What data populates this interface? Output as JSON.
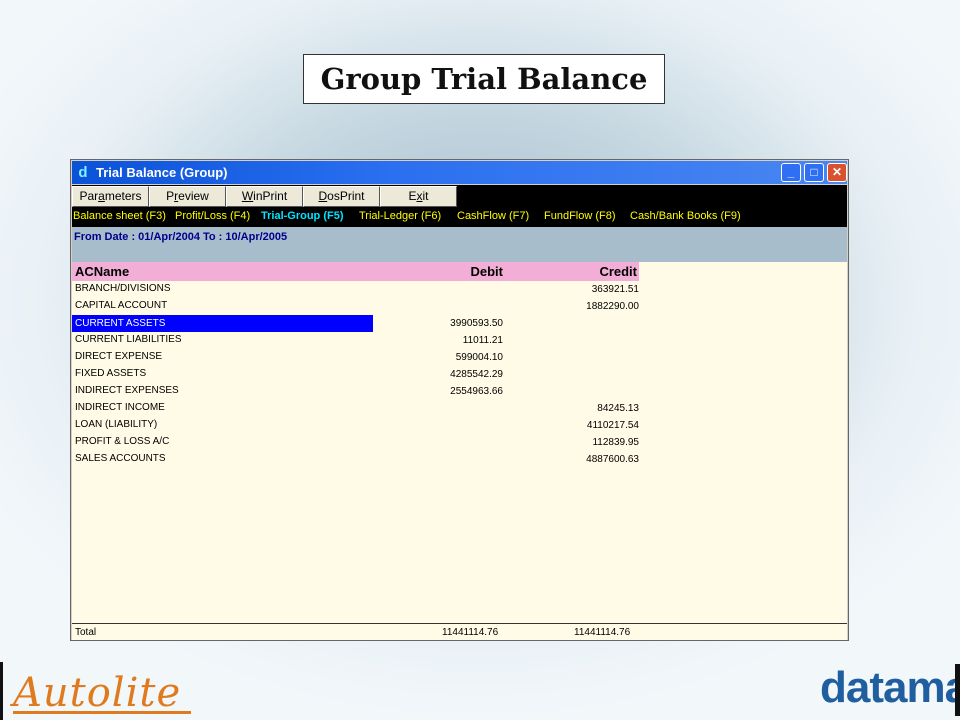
{
  "slide": {
    "title": "Group Trial Balance",
    "title_tail": " "
  },
  "window": {
    "title": "Trial Balance (Group)",
    "app_icon": "d",
    "controls": {
      "minimize": "_",
      "maximize": "□",
      "close": "✕"
    }
  },
  "toolbar": {
    "buttons": [
      {
        "pre": "Par",
        "hot": "a",
        "post": "meters"
      },
      {
        "pre": "P",
        "hot": "r",
        "post": "eview"
      },
      {
        "pre": "",
        "hot": "W",
        "post": "inPrint"
      },
      {
        "pre": "",
        "hot": "D",
        "post": "osPrint"
      },
      {
        "pre": "E",
        "hot": "x",
        "post": "it"
      }
    ]
  },
  "menu": {
    "items": [
      "Balance sheet (F3)",
      "Profit/Loss (F4)",
      "Trial-Group (F5)",
      "Trial-Ledger (F6)",
      "CashFlow (F7)",
      "FundFlow (F8)",
      "Cash/Bank Books (F9)"
    ],
    "active_index": 2
  },
  "date_range": "From Date : 01/Apr/2004 To : 10/Apr/2005",
  "table": {
    "columns": {
      "name": "ACName",
      "debit": "Debit",
      "credit": "Credit"
    },
    "selected_index": 2,
    "rows": [
      {
        "name": "BRANCH/DIVISIONS",
        "debit": "",
        "credit": "363921.51"
      },
      {
        "name": "CAPITAL ACCOUNT",
        "debit": "",
        "credit": "1882290.00"
      },
      {
        "name": "CURRENT ASSETS",
        "debit": "3990593.50",
        "credit": ""
      },
      {
        "name": "CURRENT LIABILITIES",
        "debit": "11011.21",
        "credit": ""
      },
      {
        "name": "DIRECT EXPENSE",
        "debit": "599004.10",
        "credit": ""
      },
      {
        "name": "FIXED ASSETS",
        "debit": "4285542.29",
        "credit": ""
      },
      {
        "name": "INDIRECT EXPENSES",
        "debit": "2554963.66",
        "credit": ""
      },
      {
        "name": "INDIRECT INCOME",
        "debit": "",
        "credit": "84245.13"
      },
      {
        "name": "LOAN (LIABILITY)",
        "debit": "",
        "credit": "4110217.54"
      },
      {
        "name": "PROFIT & LOSS A/C",
        "debit": "",
        "credit": "112839.95"
      },
      {
        "name": "SALES ACCOUNTS",
        "debit": "",
        "credit": "4887600.63"
      }
    ],
    "total": {
      "label": "Total",
      "debit": "11441114.76",
      "credit": "11441114.76"
    }
  },
  "logos": {
    "left": "Autolite",
    "right": "dataman"
  },
  "colors": {
    "titlebar": "#0a52d8",
    "menu_text": "#ffff00",
    "menu_active": "#00e5ff",
    "header_bg": "#f2aed6",
    "selection_bg": "#0000ff",
    "grid_bg": "#fffbe6"
  }
}
